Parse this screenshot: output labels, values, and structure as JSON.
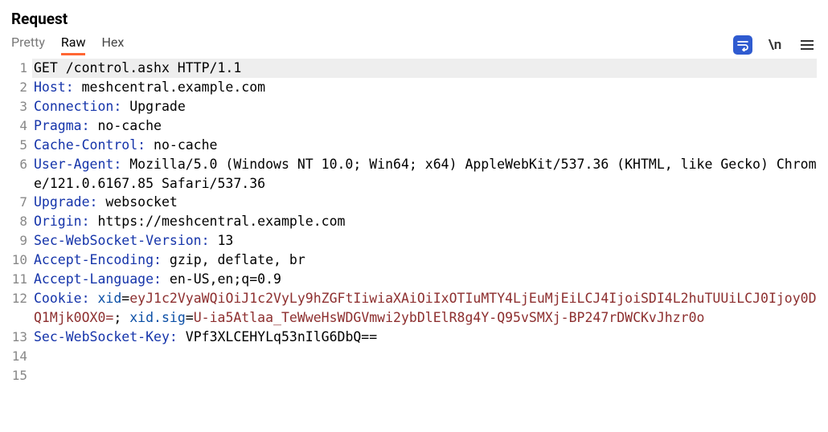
{
  "title": "Request",
  "tabs": {
    "pretty": "Pretty",
    "raw": "Raw",
    "hex": "Hex",
    "active": "raw"
  },
  "toolbar": {
    "newline_label": "\\n"
  },
  "request_line": "GET /control.ashx HTTP/1.1",
  "headers": {
    "host_name": "Host",
    "host_value": "meshcentral.example.com",
    "connection_name": "Connection",
    "connection_value": "Upgrade",
    "pragma_name": "Pragma",
    "pragma_value": "no-cache",
    "cache_control_name": "Cache-Control",
    "cache_control_value": "no-cache",
    "user_agent_name": "User-Agent",
    "user_agent_value": "Mozilla/5.0 (Windows NT 10.0; Win64; x64) AppleWebKit/537.36 (KHTML, like Gecko) Chrome/121.0.6167.85 Safari/537.36",
    "upgrade_name": "Upgrade",
    "upgrade_value": "websocket",
    "origin_name": "Origin",
    "origin_value": "https://meshcentral.example.com",
    "ws_version_name": "Sec-WebSocket-Version",
    "ws_version_value": "13",
    "accept_encoding_name": "Accept-Encoding",
    "accept_encoding_value": "gzip, deflate, br",
    "accept_language_name": "Accept-Language",
    "accept_language_value": "en-US,en;q=0.9",
    "cookie_name": "Cookie",
    "cookie_xid_key": "xid",
    "cookie_xid_eq": "=",
    "cookie_xid_val": "eyJ1c2VyaWQiOiJ1c2VyLy9hZGFtIiwiaXAiOiIxOTIuMTY4LjEuMjEiLCJ4IjoiSDI4L2huTUUiLCJ0Ijoy0DQ1Mjk0OX0=",
    "cookie_sep": "; ",
    "cookie_sig_key": "xid.sig",
    "cookie_sig_eq": "=",
    "cookie_sig_val": "U-ia5Atlaa_TeWweHsWDGVmwi2ybDlElR8g4Y-Q95vSMXj-BP247rDWCKvJhzr0o",
    "ws_key_name": "Sec-WebSocket-Key",
    "ws_key_value": "VPf3XLCEHYLq53nIlG6DbQ=="
  },
  "line_numbers": {
    "l1": "1",
    "l2": "2",
    "l3": "3",
    "l4": "4",
    "l5": "5",
    "l6": "6",
    "l7": "7",
    "l8": "8",
    "l9": "9",
    "l10": "10",
    "l11": "11",
    "l12": "12",
    "l13": "13",
    "l14": "14",
    "l15": "15"
  }
}
